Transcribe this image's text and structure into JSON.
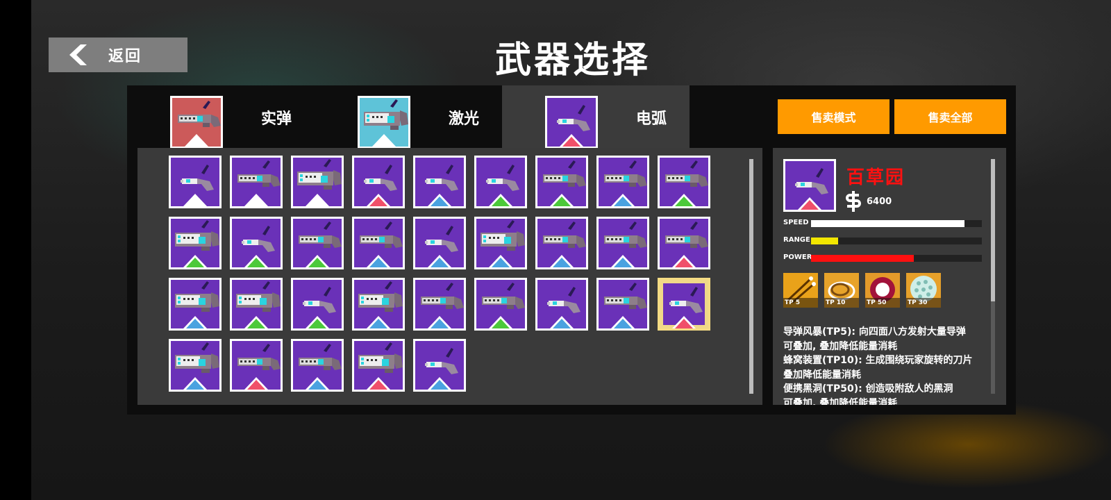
{
  "header": {
    "back_label": "返回",
    "title": "武器选择"
  },
  "tabs": [
    {
      "label": "实弹",
      "icon": "bullet-gun-icon",
      "color": "#cc5a5a",
      "active": false
    },
    {
      "label": "激光",
      "icon": "laser-gun-icon",
      "color": "#5ec3d8",
      "active": false
    },
    {
      "label": "电弧",
      "icon": "arc-gun-icon",
      "color": "#6a31b8",
      "active": true
    }
  ],
  "actions": {
    "sell_mode_label": "售卖模式",
    "sell_all_label": "售卖全部"
  },
  "colors": {
    "white": "#ffffff",
    "red": "#f0506a",
    "blue": "#4aa2e0",
    "green": "#4cc93a",
    "accent_orange": "#ff9a00",
    "name_red": "#ff1010"
  },
  "inventory": {
    "rows": [
      [
        {
          "w": "small",
          "t": "white"
        },
        {
          "w": "medium",
          "t": "white"
        },
        {
          "w": "large",
          "t": "white"
        },
        {
          "w": "small",
          "t": "red"
        },
        {
          "w": "small",
          "t": "blue"
        },
        {
          "w": "small",
          "t": "green"
        },
        {
          "w": "medium",
          "t": "green"
        },
        {
          "w": "medium",
          "t": "blue"
        },
        {
          "w": "medium",
          "t": "green"
        }
      ],
      [
        {
          "w": "large",
          "t": "green"
        },
        {
          "w": "small",
          "t": "green"
        },
        {
          "w": "medium",
          "t": "green"
        },
        {
          "w": "medium",
          "t": "blue"
        },
        {
          "w": "small",
          "t": "blue"
        },
        {
          "w": "large",
          "t": "blue"
        },
        {
          "w": "medium",
          "t": "blue"
        },
        {
          "w": "medium",
          "t": "blue"
        },
        {
          "w": "medium",
          "t": "red"
        }
      ],
      [
        {
          "w": "large",
          "t": "blue"
        },
        {
          "w": "large",
          "t": "green"
        },
        {
          "w": "small",
          "t": "green"
        },
        {
          "w": "large",
          "t": "blue"
        },
        {
          "w": "medium",
          "t": "blue"
        },
        {
          "w": "medium",
          "t": "green"
        },
        {
          "w": "small",
          "t": "blue"
        },
        {
          "w": "medium",
          "t": "blue"
        },
        {
          "w": "small",
          "t": "red",
          "selected": true
        }
      ],
      [
        {
          "w": "large",
          "t": "blue"
        },
        {
          "w": "medium",
          "t": "red"
        },
        {
          "w": "medium",
          "t": "blue"
        },
        {
          "w": "large",
          "t": "red"
        },
        {
          "w": "small",
          "t": "blue"
        }
      ]
    ]
  },
  "detail": {
    "name": "百草园",
    "price": "6400",
    "price_icon": "dollar-icon",
    "stats": [
      {
        "label": "SPEED",
        "value": 0.9,
        "color": "#ffffff"
      },
      {
        "label": "RANGE",
        "value": 0.16,
        "color": "#f2e600"
      },
      {
        "label": "POWER",
        "value": 0.6,
        "color": "#ff1010"
      }
    ],
    "skills": [
      {
        "label": "TP 5",
        "icon": "missile-storm-icon"
      },
      {
        "label": "TP 10",
        "icon": "hive-blades-icon"
      },
      {
        "label": "TP 50",
        "icon": "black-hole-icon"
      },
      {
        "label": "TP 30",
        "icon": "shield-ball-icon"
      }
    ],
    "description": [
      "导弹风暴(TP5): 向四面八方发射大量导弹",
      "可叠加, 叠加降低能量消耗",
      "蜂窝装置(TP10): 生成围绕玩家旋转的刀片",
      "叠加降低能量消耗",
      "便携黑洞(TP50): 创造吸附敌人的黑洞",
      "可叠加, 叠加降低能量消耗"
    ]
  }
}
